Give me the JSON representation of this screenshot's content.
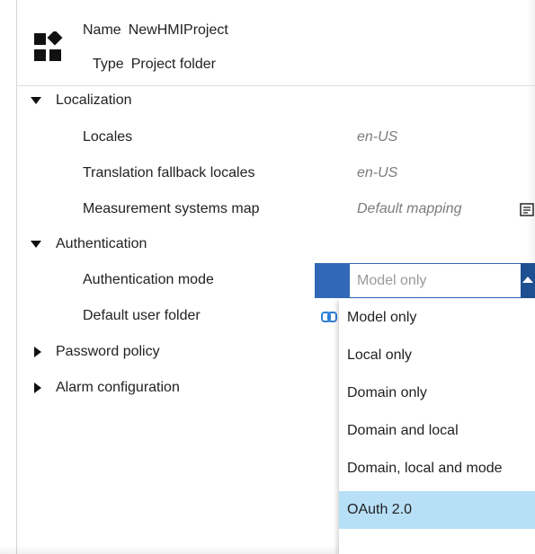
{
  "header": {
    "name_key": "Name",
    "name_value": "NewHMIProject",
    "type_key": "Type",
    "type_value": "Project folder",
    "icon": "project-folder-icon"
  },
  "localization": {
    "label": "Localization",
    "expanded": true,
    "props": [
      {
        "label": "Locales",
        "value": "en-US"
      },
      {
        "label": "Translation fallback locales",
        "value": "en-US"
      },
      {
        "label": "Measurement systems map",
        "value": "Default mapping"
      }
    ],
    "map_icon": "mapping-editor-icon"
  },
  "authentication": {
    "label": "Authentication",
    "expanded": true,
    "mode_label": "Authentication mode",
    "mode_placeholder": "Model only",
    "default_user_folder_label": "Default user folder",
    "link_icon": "link-icon",
    "options": [
      "Model only",
      "Local only",
      "Domain only",
      "Domain and local",
      "Domain, local and mode",
      "OAuth 2.0"
    ],
    "highlighted_index": 5
  },
  "password_policy": {
    "label": "Password policy",
    "expanded": false
  },
  "alarm_configuration": {
    "label": "Alarm configuration",
    "expanded": false
  },
  "colors": {
    "accent": "#3168b7",
    "accent_dark": "#1d4f91",
    "highlight": "#b7e0f7",
    "value_text": "#7c7c7c"
  }
}
